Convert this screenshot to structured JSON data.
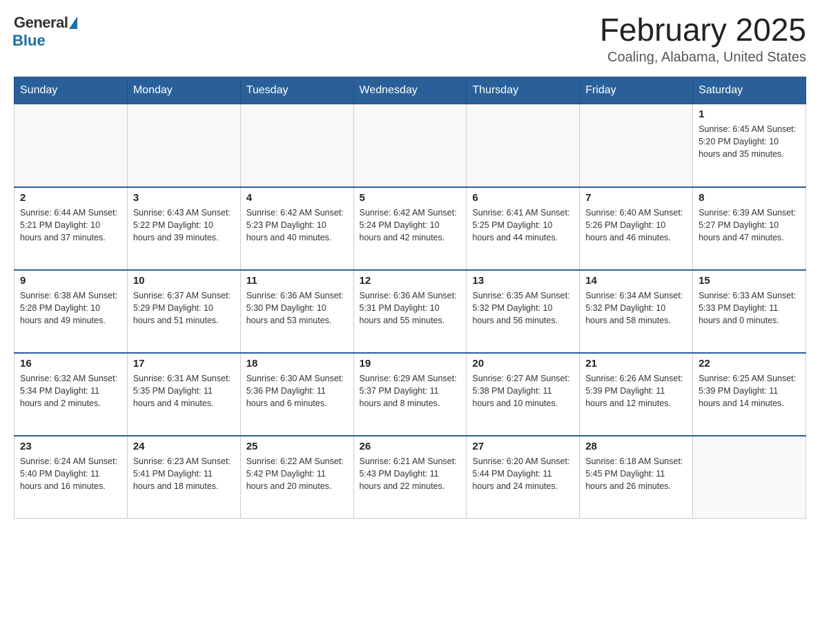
{
  "header": {
    "logo_general": "General",
    "logo_blue": "Blue",
    "month_title": "February 2025",
    "location": "Coaling, Alabama, United States"
  },
  "weekdays": [
    "Sunday",
    "Monday",
    "Tuesday",
    "Wednesday",
    "Thursday",
    "Friday",
    "Saturday"
  ],
  "weeks": [
    [
      {
        "day": "",
        "info": ""
      },
      {
        "day": "",
        "info": ""
      },
      {
        "day": "",
        "info": ""
      },
      {
        "day": "",
        "info": ""
      },
      {
        "day": "",
        "info": ""
      },
      {
        "day": "",
        "info": ""
      },
      {
        "day": "1",
        "info": "Sunrise: 6:45 AM\nSunset: 5:20 PM\nDaylight: 10 hours and 35 minutes."
      }
    ],
    [
      {
        "day": "2",
        "info": "Sunrise: 6:44 AM\nSunset: 5:21 PM\nDaylight: 10 hours and 37 minutes."
      },
      {
        "day": "3",
        "info": "Sunrise: 6:43 AM\nSunset: 5:22 PM\nDaylight: 10 hours and 39 minutes."
      },
      {
        "day": "4",
        "info": "Sunrise: 6:42 AM\nSunset: 5:23 PM\nDaylight: 10 hours and 40 minutes."
      },
      {
        "day": "5",
        "info": "Sunrise: 6:42 AM\nSunset: 5:24 PM\nDaylight: 10 hours and 42 minutes."
      },
      {
        "day": "6",
        "info": "Sunrise: 6:41 AM\nSunset: 5:25 PM\nDaylight: 10 hours and 44 minutes."
      },
      {
        "day": "7",
        "info": "Sunrise: 6:40 AM\nSunset: 5:26 PM\nDaylight: 10 hours and 46 minutes."
      },
      {
        "day": "8",
        "info": "Sunrise: 6:39 AM\nSunset: 5:27 PM\nDaylight: 10 hours and 47 minutes."
      }
    ],
    [
      {
        "day": "9",
        "info": "Sunrise: 6:38 AM\nSunset: 5:28 PM\nDaylight: 10 hours and 49 minutes."
      },
      {
        "day": "10",
        "info": "Sunrise: 6:37 AM\nSunset: 5:29 PM\nDaylight: 10 hours and 51 minutes."
      },
      {
        "day": "11",
        "info": "Sunrise: 6:36 AM\nSunset: 5:30 PM\nDaylight: 10 hours and 53 minutes."
      },
      {
        "day": "12",
        "info": "Sunrise: 6:36 AM\nSunset: 5:31 PM\nDaylight: 10 hours and 55 minutes."
      },
      {
        "day": "13",
        "info": "Sunrise: 6:35 AM\nSunset: 5:32 PM\nDaylight: 10 hours and 56 minutes."
      },
      {
        "day": "14",
        "info": "Sunrise: 6:34 AM\nSunset: 5:32 PM\nDaylight: 10 hours and 58 minutes."
      },
      {
        "day": "15",
        "info": "Sunrise: 6:33 AM\nSunset: 5:33 PM\nDaylight: 11 hours and 0 minutes."
      }
    ],
    [
      {
        "day": "16",
        "info": "Sunrise: 6:32 AM\nSunset: 5:34 PM\nDaylight: 11 hours and 2 minutes."
      },
      {
        "day": "17",
        "info": "Sunrise: 6:31 AM\nSunset: 5:35 PM\nDaylight: 11 hours and 4 minutes."
      },
      {
        "day": "18",
        "info": "Sunrise: 6:30 AM\nSunset: 5:36 PM\nDaylight: 11 hours and 6 minutes."
      },
      {
        "day": "19",
        "info": "Sunrise: 6:29 AM\nSunset: 5:37 PM\nDaylight: 11 hours and 8 minutes."
      },
      {
        "day": "20",
        "info": "Sunrise: 6:27 AM\nSunset: 5:38 PM\nDaylight: 11 hours and 10 minutes."
      },
      {
        "day": "21",
        "info": "Sunrise: 6:26 AM\nSunset: 5:39 PM\nDaylight: 11 hours and 12 minutes."
      },
      {
        "day": "22",
        "info": "Sunrise: 6:25 AM\nSunset: 5:39 PM\nDaylight: 11 hours and 14 minutes."
      }
    ],
    [
      {
        "day": "23",
        "info": "Sunrise: 6:24 AM\nSunset: 5:40 PM\nDaylight: 11 hours and 16 minutes."
      },
      {
        "day": "24",
        "info": "Sunrise: 6:23 AM\nSunset: 5:41 PM\nDaylight: 11 hours and 18 minutes."
      },
      {
        "day": "25",
        "info": "Sunrise: 6:22 AM\nSunset: 5:42 PM\nDaylight: 11 hours and 20 minutes."
      },
      {
        "day": "26",
        "info": "Sunrise: 6:21 AM\nSunset: 5:43 PM\nDaylight: 11 hours and 22 minutes."
      },
      {
        "day": "27",
        "info": "Sunrise: 6:20 AM\nSunset: 5:44 PM\nDaylight: 11 hours and 24 minutes."
      },
      {
        "day": "28",
        "info": "Sunrise: 6:18 AM\nSunset: 5:45 PM\nDaylight: 11 hours and 26 minutes."
      },
      {
        "day": "",
        "info": ""
      }
    ]
  ]
}
